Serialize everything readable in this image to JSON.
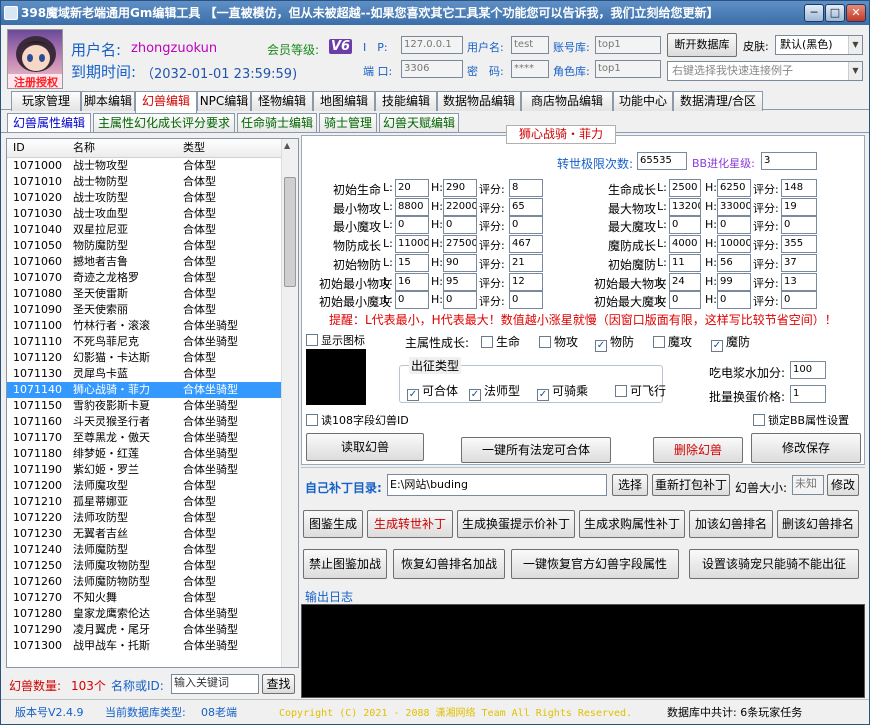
{
  "window": {
    "title": "398魔域新老端通用Gm编辑工具 【一直被模仿，但从未被超越--如果您喜欢其它工具某个功能您可以告诉我，我们立刻给您更新】",
    "min": "─",
    "max": "□",
    "close": "✕"
  },
  "header": {
    "avatar_caption": "注册授权",
    "user_label": "用户名:",
    "user_value": "zhongzuokun",
    "expire_label": "到期时间:",
    "expire_value": "（2032-01-01 23:59:59)",
    "vip_label": "会员等级:",
    "vip_value": "V6",
    "ip_label": "I　P:",
    "ip_value": "127.0.0.1",
    "port_label": "端 口:",
    "port_value": "3306",
    "dbuser_label": "用户名:",
    "dbuser_value": "test",
    "dbpass_label": "密　码:",
    "dbpass_value": "****",
    "acct_label": "账号库:",
    "acct_value": "top1",
    "role_label": "角色库:",
    "role_value": "top1",
    "disconnect_btn": "断开数据库",
    "skin_label": "皮肤:",
    "skin_value": "默认(黑色)",
    "conn_placeholder": "右键选择我快速连接例子"
  },
  "tabs": [
    "玩家管理",
    "脚本编辑",
    "幻兽编辑",
    "NPC编辑",
    "怪物编辑",
    "地图编辑",
    "技能编辑",
    "数据物品编辑",
    "商店物品编辑",
    "功能中心",
    "数据清理/合区"
  ],
  "subtabs": [
    "幻兽属性编辑",
    "主属性幻化成长评分要求",
    "任命骑士编辑",
    "骑士管理",
    "幻兽天赋编辑"
  ],
  "list": {
    "headers": [
      "ID",
      "名称",
      "类型"
    ],
    "rows": [
      [
        "1071000",
        "战士物攻型",
        "合体型"
      ],
      [
        "1071010",
        "战士物防型",
        "合体型"
      ],
      [
        "1071020",
        "战士攻防型",
        "合体型"
      ],
      [
        "1071030",
        "战士攻血型",
        "合体型"
      ],
      [
        "1071040",
        "双星拉尼亚",
        "合体型"
      ],
      [
        "1071050",
        "物防魔防型",
        "合体型"
      ],
      [
        "1071060",
        "撼地者吉鲁",
        "合体型"
      ],
      [
        "1071070",
        "奇迹之龙格罗",
        "合体型"
      ],
      [
        "1071080",
        "圣天使雷斯",
        "合体型"
      ],
      [
        "1071090",
        "圣天使索丽",
        "合体型"
      ],
      [
        "1071100",
        "竹林行者・滚滚",
        "合体坐骑型"
      ],
      [
        "1071110",
        "不死鸟菲尼克",
        "合体坐骑型"
      ],
      [
        "1071120",
        "幻影猫・卡达斯",
        "合体型"
      ],
      [
        "1071130",
        "灵犀鸟卡蓝",
        "合体型"
      ],
      [
        "1071140",
        "狮心战骑・菲力",
        "合体坐骑型"
      ],
      [
        "1071150",
        "雪豹夜影斯卡夏",
        "合体坐骑型"
      ],
      [
        "1071160",
        "斗天灵猴圣行者",
        "合体坐骑型"
      ],
      [
        "1071170",
        "至尊黑龙・傲天",
        "合体坐骑型"
      ],
      [
        "1071180",
        "绯梦姬・红莲",
        "合体坐骑型"
      ],
      [
        "1071190",
        "紫幻姬・罗兰",
        "合体坐骑型"
      ],
      [
        "1071200",
        "法师魔攻型",
        "合体型"
      ],
      [
        "1071210",
        "孤星蒂娜亚",
        "合体型"
      ],
      [
        "1071220",
        "法师攻防型",
        "合体型"
      ],
      [
        "1071230",
        "无翼者吉丝",
        "合体型"
      ],
      [
        "1071240",
        "法师魔防型",
        "合体型"
      ],
      [
        "1071250",
        "法师魔攻物防型",
        "合体型"
      ],
      [
        "1071260",
        "法师魔防物防型",
        "合体型"
      ],
      [
        "1071270",
        "不知火舞",
        "合体型"
      ],
      [
        "1071280",
        "皇家龙鹰索伦达",
        "合体坐骑型"
      ],
      [
        "1071290",
        "凌月翼虎・尾牙",
        "合体坐骑型"
      ],
      [
        "1071300",
        "战甲战车・托斯",
        "合体坐骑型"
      ]
    ],
    "selected_index": 14
  },
  "list_footer": {
    "count_label": "幻兽数量:",
    "count_value": "103个",
    "search_label": "名称或ID:",
    "search_placeholder": "输入关键词",
    "search_btn": "查找"
  },
  "detail": {
    "title": "狮心战骑・菲力",
    "rebirth_label": "转世极限次数:",
    "rebirth_value": "65535",
    "star_label": "BB进化星级:",
    "star_value": "3",
    "stats_left": [
      {
        "label": "初始生命",
        "l": "20",
        "h": "290",
        "s": "8"
      },
      {
        "label": "最小物攻",
        "l": "8800",
        "h": "22000",
        "s": "65"
      },
      {
        "label": "最小魔攻",
        "l": "0",
        "h": "0",
        "s": "0"
      },
      {
        "label": "物防成长",
        "l": "11000",
        "h": "27500",
        "s": "467"
      },
      {
        "label": "初始物防",
        "l": "15",
        "h": "90",
        "s": "21"
      },
      {
        "label": "初始最小物攻",
        "l": "16",
        "h": "95",
        "s": "12"
      },
      {
        "label": "初始最小魔攻",
        "l": "0",
        "h": "0",
        "s": "0"
      }
    ],
    "stats_right": [
      {
        "label": "生命成长",
        "l": "2500",
        "h": "6250",
        "s": "148"
      },
      {
        "label": "最大物攻",
        "l": "13200",
        "h": "33000",
        "s": "19"
      },
      {
        "label": "最大魔攻",
        "l": "0",
        "h": "0",
        "s": "0"
      },
      {
        "label": "魔防成长",
        "l": "4000",
        "h": "10000",
        "s": "355"
      },
      {
        "label": "初始魔防",
        "l": "11",
        "h": "56",
        "s": "37"
      },
      {
        "label": "初始最大物攻",
        "l": "24",
        "h": "99",
        "s": "13"
      },
      {
        "label": "初始最大魔攻",
        "l": "0",
        "h": "0",
        "s": "0"
      }
    ],
    "l_label": "L:",
    "h_label": "H:",
    "score_label": "评分:",
    "hint": "提醒：L代表最小，H代表最大！数值越小涨星就慢（因窗口版面有限，这样写比较节省空间）！",
    "show_icon": "显示图标",
    "main_growth_label": "主属性成长:",
    "growth_opts": [
      "生命",
      "物攻",
      "物防",
      "魔攻",
      "魔防"
    ],
    "growth_checked": [
      false,
      false,
      true,
      false,
      true
    ],
    "type_group": "出征类型",
    "type_opts": [
      "可合体",
      "法师型",
      "可骑乘",
      "可飞行"
    ],
    "type_checked": [
      true,
      true,
      true,
      false
    ],
    "drink_label": "吃电浆水加分:",
    "drink_value": "100",
    "egg_label": "批量换蛋价格:",
    "egg_value": "1",
    "read108": "读108字段幻兽ID",
    "lock_bb": "锁定BB属性设置",
    "read_btn": "读取幻兽",
    "all_merge_btn": "一键所有法宠可合体",
    "delete_btn": "删除幻兽",
    "save_btn": "修改保存"
  },
  "patch": {
    "dir_label": "自己补丁目录:",
    "dir_value": "E:\\网站\\buding",
    "choose_btn": "选择",
    "repack_btn": "重新打包补丁",
    "size_label": "幻兽大小:",
    "size_value": "未知",
    "modify_btn": "修改",
    "row1": [
      "图鉴生成",
      "生成转世补丁",
      "生成换蛋提示价补丁",
      "生成求购属性补丁",
      "加该幻兽排名",
      "删该幻兽排名"
    ],
    "row2": [
      "禁止图鉴加战",
      "恢复幻兽排名加战",
      "一键恢复官方幻兽字段属性",
      "设置该骑宠只能骑不能出征"
    ],
    "log_label": "输出日志"
  },
  "status": {
    "version": "版本号V2.4.9",
    "db_type_label": "当前数据库类型:",
    "db_type": "08老端",
    "copyright": "Copyright (C) 2021 - 2088 潇湘网络 Team All Rights Reserved.",
    "summary": "数据库中共计: 6条玩家任务"
  },
  "colors": {
    "accent": "#1560c8",
    "title": "#3b6ea8",
    "selected": "#3399ff",
    "hint": "#e00000",
    "log_bg": "#000000"
  }
}
